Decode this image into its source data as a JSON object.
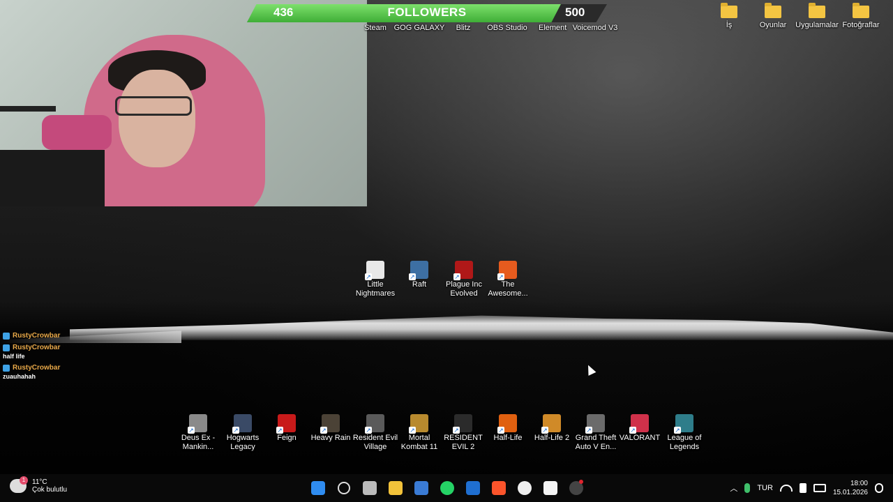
{
  "followers": {
    "current": "436",
    "label": "FOLLOWERS",
    "goal": "500",
    "progress_fraction": 0.872
  },
  "top_apps": [
    {
      "label": "Steam",
      "icon": "steam-icon"
    },
    {
      "label": "GOG GALAXY",
      "icon": "gog-galaxy-icon"
    },
    {
      "label": "Blitz",
      "icon": "blitz-icon"
    },
    {
      "label": "OBS Studio",
      "icon": "obs-studio-icon"
    },
    {
      "label": "Element",
      "icon": "element-icon"
    },
    {
      "label": "Voicemod V3",
      "icon": "voicemod-icon"
    }
  ],
  "top_folders": [
    {
      "label": "İş"
    },
    {
      "label": "Oyunlar"
    },
    {
      "label": "Uygulamalar"
    },
    {
      "label": "Fotoğraflar"
    }
  ],
  "middle_icons": [
    {
      "label": "Little Nightmares",
      "color": "#e8e8e8"
    },
    {
      "label": "Raft",
      "color": "#3d6fa3"
    },
    {
      "label": "Plague Inc Evolved",
      "color": "#b01818"
    },
    {
      "label": "The Awesome...",
      "color": "#e65b1e"
    }
  ],
  "bottom_icons": [
    {
      "label": "Deus Ex - Mankin...",
      "color": "#8a8a8a"
    },
    {
      "label": "Hogwarts Legacy",
      "color": "#3a4a66"
    },
    {
      "label": "Feign",
      "color": "#c81a1a"
    },
    {
      "label": "Heavy Rain",
      "color": "#4b4236"
    },
    {
      "label": "Resident Evil Village",
      "color": "#5a5a5a"
    },
    {
      "label": "Mortal Kombat 11",
      "color": "#b88a2e"
    },
    {
      "label": "RESIDENT EVIL 2",
      "color": "#2b2b2b"
    },
    {
      "label": "Half-Life",
      "color": "#e06010"
    },
    {
      "label": "Half-Life 2",
      "color": "#d08a28"
    },
    {
      "label": "Grand Theft Auto V En...",
      "color": "#6b6b6b"
    },
    {
      "label": "VALORANT",
      "color": "#d0314a"
    },
    {
      "label": "League of Legends",
      "color": "#2e7d8a"
    }
  ],
  "chat": [
    {
      "user": "RustyCrowbar",
      "text": ""
    },
    {
      "user": "RustyCrowbar",
      "text": "half life"
    },
    {
      "user": "RustyCrowbar",
      "text": "zuauhahah"
    }
  ],
  "taskbar": {
    "weather_badge": "1",
    "temperature": "11°C",
    "condition": "Çok bulutlu",
    "apps": [
      {
        "name": "start-icon",
        "color": "#2f8cf0"
      },
      {
        "name": "search-icon",
        "color": "#dddddd"
      },
      {
        "name": "task-view-icon",
        "color": "#bbbbbb"
      },
      {
        "name": "file-explorer-icon",
        "color": "#f2c23a"
      },
      {
        "name": "microsoft-store-icon",
        "color": "#3a7bd5"
      },
      {
        "name": "whatsapp-icon",
        "color": "#25d366"
      },
      {
        "name": "outlook-icon",
        "color": "#1f6fd1"
      },
      {
        "name": "brave-icon",
        "color": "#fb542b"
      },
      {
        "name": "chatgpt-icon",
        "color": "#eeeeee"
      },
      {
        "name": "notion-icon",
        "color": "#f4f4f4"
      },
      {
        "name": "obs-icon",
        "color": "#444444"
      }
    ],
    "language": "TUR",
    "time": "18:00",
    "date": "15.01.2026"
  }
}
